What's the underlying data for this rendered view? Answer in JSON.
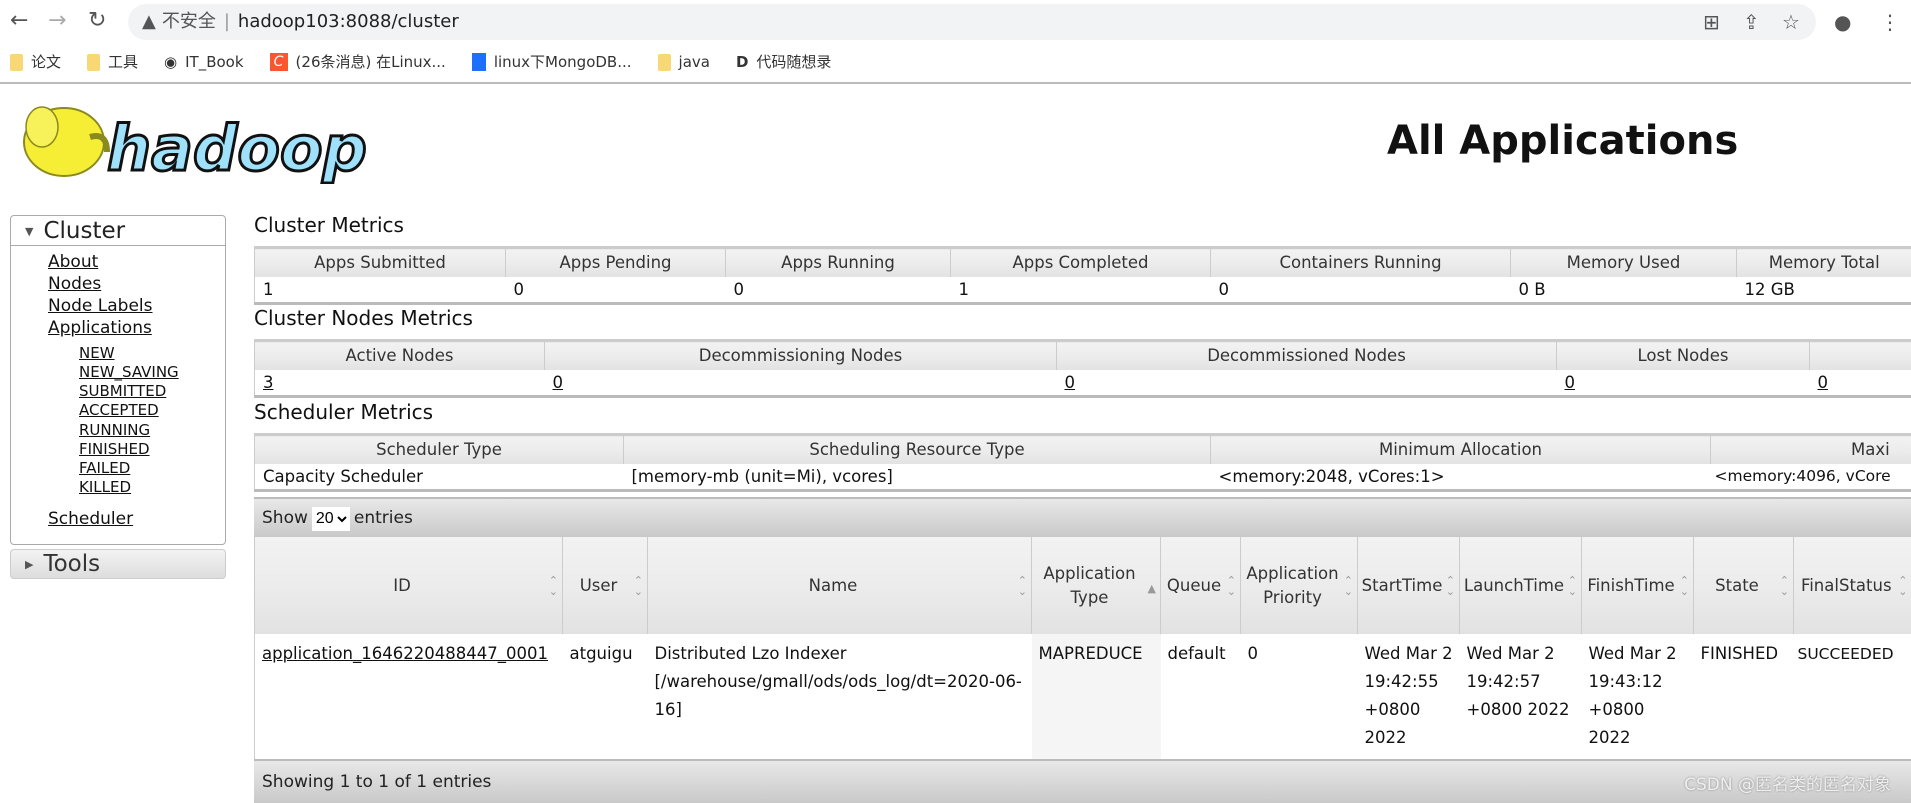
{
  "browser": {
    "insecure_label": "不安全",
    "url": "hadoop103:8088/cluster",
    "bookmarks": [
      {
        "label": "论文",
        "icon": "folder-icon"
      },
      {
        "label": "工具",
        "icon": "folder-icon"
      },
      {
        "label": "IT_Book",
        "icon": "github-icon"
      },
      {
        "label": "(26条消息) 在Linux...",
        "icon": "csdn-icon"
      },
      {
        "label": "linux下MongoDB...",
        "icon": "blog-icon"
      },
      {
        "label": "java",
        "icon": "folder-icon"
      },
      {
        "label": "代码随想录",
        "icon": "site-icon"
      }
    ]
  },
  "header": {
    "logo_text": "hadoop",
    "title": "All Applications"
  },
  "sidebar": {
    "cluster": "Cluster",
    "links": [
      "About",
      "Nodes",
      "Node Labels",
      "Applications"
    ],
    "states": [
      "NEW",
      "NEW_SAVING",
      "SUBMITTED",
      "ACCEPTED",
      "RUNNING",
      "FINISHED",
      "FAILED",
      "KILLED"
    ],
    "scheduler": "Scheduler",
    "tools": "Tools"
  },
  "cluster_metrics": {
    "title": "Cluster Metrics",
    "headers": [
      "Apps Submitted",
      "Apps Pending",
      "Apps Running",
      "Apps Completed",
      "Containers Running",
      "Memory Used",
      "Memory Total"
    ],
    "values": [
      "1",
      "0",
      "0",
      "1",
      "0",
      "0 B",
      "12 GB"
    ]
  },
  "nodes_metrics": {
    "title": "Cluster Nodes Metrics",
    "headers": [
      "Active Nodes",
      "Decommissioning Nodes",
      "Decommissioned Nodes",
      "Lost Nodes",
      ""
    ],
    "values": [
      "3",
      "0",
      "0",
      "0",
      "0"
    ]
  },
  "scheduler_metrics": {
    "title": "Scheduler Metrics",
    "headers": [
      "Scheduler Type",
      "Scheduling Resource Type",
      "Minimum Allocation",
      "Maxi"
    ],
    "values": [
      "Capacity Scheduler",
      "[memory-mb (unit=Mi), vcores]",
      "<memory:2048, vCores:1>",
      "<memory:4096, vCore"
    ]
  },
  "apps": {
    "show_label": "Show",
    "entries_label": "entries",
    "page_size": "20",
    "headers": [
      "ID",
      "User",
      "Name",
      "Application Type",
      "Queue",
      "Application Priority",
      "StartTime",
      "LaunchTime",
      "FinishTime",
      "State",
      "FinalStatus"
    ],
    "rows": [
      [
        "application_1646220488447_0001",
        "atguigu",
        "Distributed Lzo Indexer [/warehouse/gmall/ods/ods_log/dt=2020-06-16]",
        "MAPREDUCE",
        "default",
        "0",
        "Wed Mar 2 19:42:55 +0800 2022",
        "Wed Mar 2 19:42:57 +0800 2022",
        "Wed Mar 2 19:43:12 +0800 2022",
        "FINISHED",
        "SUCCEEDED"
      ]
    ],
    "footer": "Showing 1 to 1 of 1 entries"
  },
  "watermark": "CSDN @匿名类的匿名对象"
}
